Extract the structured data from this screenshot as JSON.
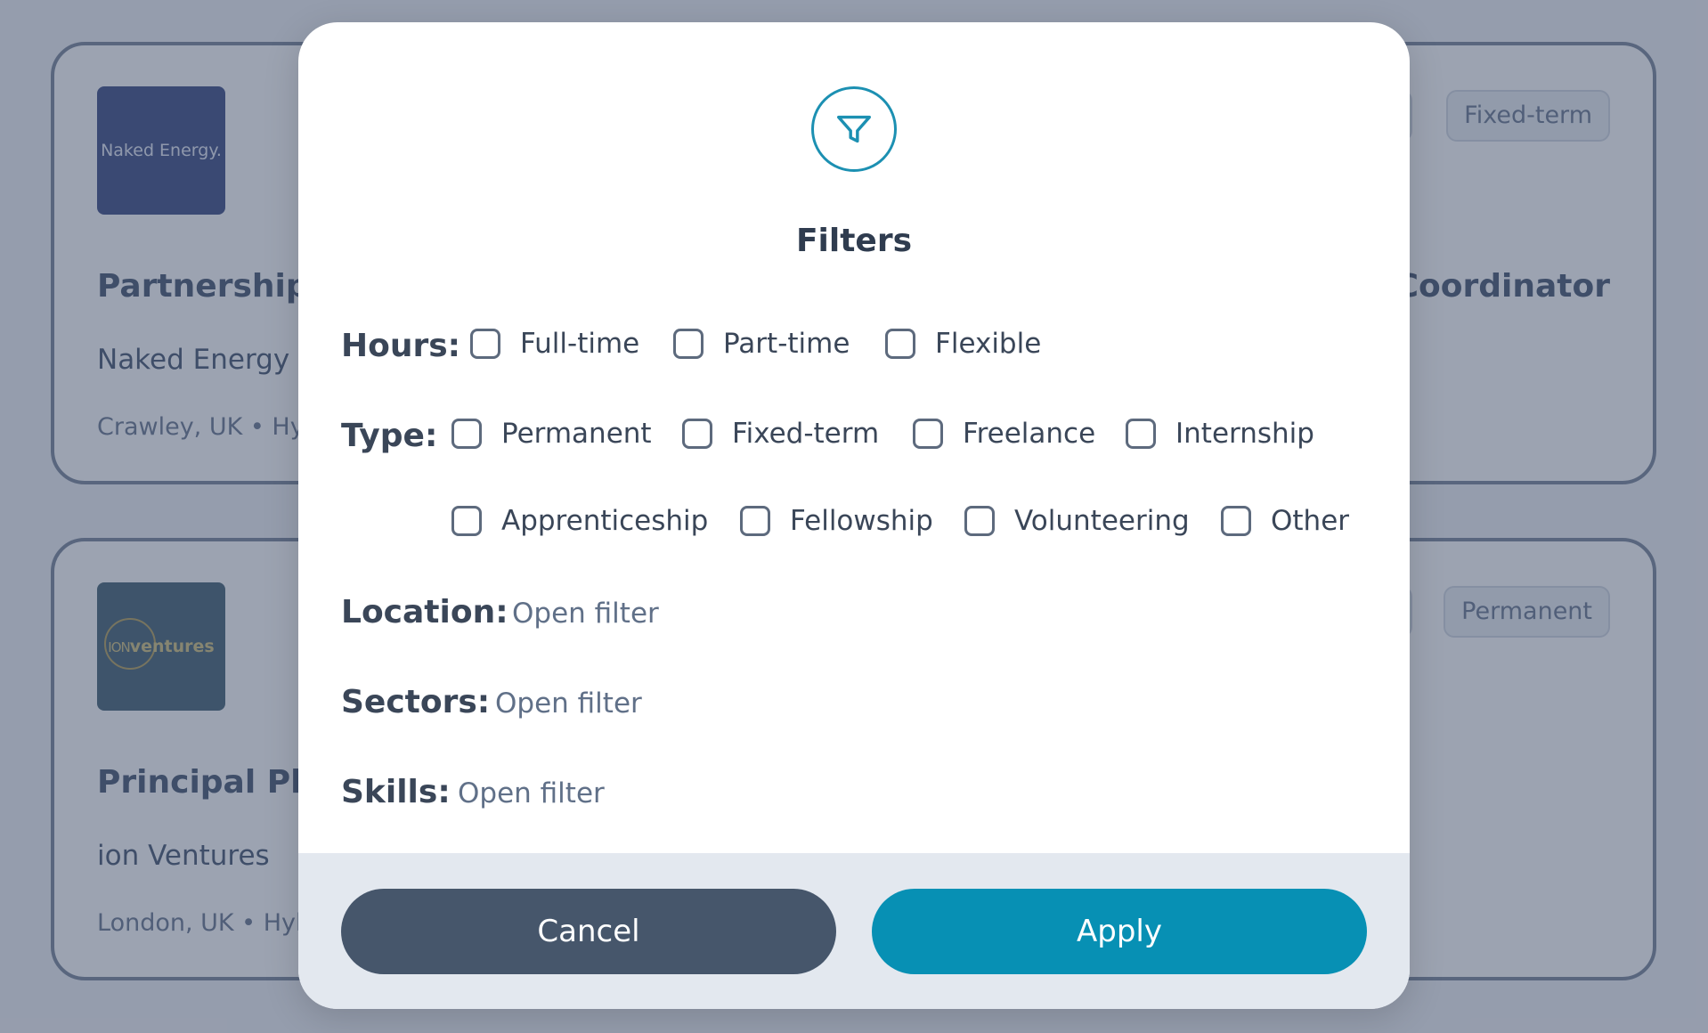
{
  "background_cards": [
    {
      "logo_text": "Naked Energy.",
      "title": "Partnerships",
      "company": "Naked Energy Ltd",
      "location": "Crawley, UK • Hybrid",
      "right_title": "s Coordinator",
      "tag": "Fixed-term"
    },
    {
      "logo_text_small": "ION",
      "logo_text_bold": "ventures",
      "title": "Principal Plan",
      "company": "ion Ventures",
      "location": "London, UK • Hybrid",
      "tag": "Permanent"
    }
  ],
  "modal": {
    "icon": "funnel-icon",
    "title": "Filters",
    "hours": {
      "label": "Hours:",
      "options": [
        "Full-time",
        "Part-time",
        "Flexible"
      ]
    },
    "type": {
      "label": "Type:",
      "options": [
        "Permanent",
        "Fixed-term",
        "Freelance",
        "Internship",
        "Apprenticeship",
        "Fellowship",
        "Volunteering",
        "Other"
      ]
    },
    "location": {
      "label": "Location:",
      "link": "Open filter"
    },
    "sectors": {
      "label": "Sectors:",
      "link": "Open filter"
    },
    "skills": {
      "label": "Skills:",
      "link": "Open filter"
    },
    "cancel_label": "Cancel",
    "apply_label": "Apply"
  },
  "colors": {
    "accent": "#0790b4",
    "cancel": "#46566b",
    "overlay": "#243252"
  }
}
